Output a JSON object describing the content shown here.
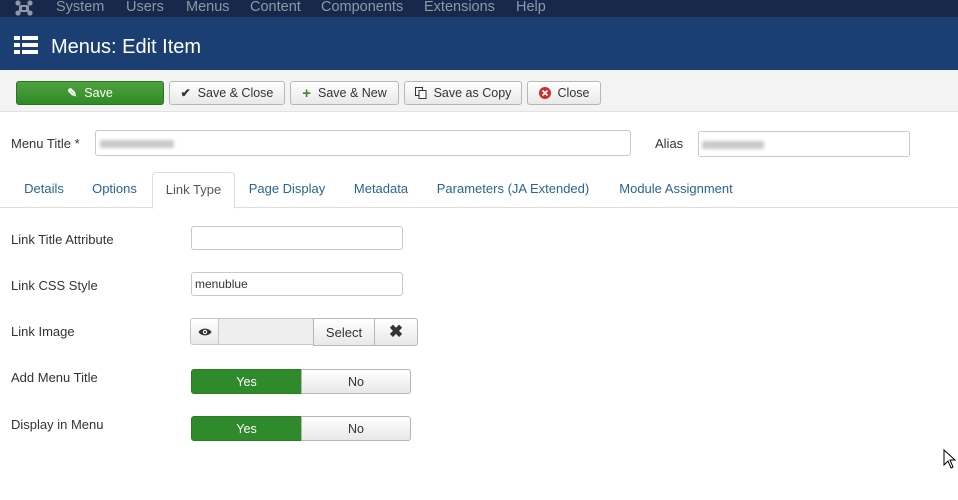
{
  "topnav": {
    "items": [
      "System",
      "Users",
      "Menus",
      "Content",
      "Components",
      "Extensions",
      "Help"
    ]
  },
  "header": {
    "title": "Menus: Edit Item"
  },
  "toolbar": {
    "save": "Save",
    "save_close": "Save & Close",
    "save_new": "Save & New",
    "save_copy": "Save as Copy",
    "close": "Close"
  },
  "fields": {
    "menu_title_label": "Menu Title *",
    "alias_label": "Alias"
  },
  "tabs": [
    "Details",
    "Options",
    "Link Type",
    "Page Display",
    "Metadata",
    "Parameters (JA Extended)",
    "Module Assignment"
  ],
  "active_tab": "Link Type",
  "form": {
    "link_title_attribute_label": "Link Title Attribute",
    "link_title_attribute_value": "",
    "link_css_style_label": "Link CSS Style",
    "link_css_style_value": "menublue",
    "link_image_label": "Link Image",
    "select_label": "Select",
    "add_menu_title_label": "Add Menu Title",
    "display_in_menu_label": "Display in Menu",
    "yes": "Yes",
    "no": "No"
  },
  "colors": {
    "nav_bg": "#17294a",
    "header_bg": "#1b3f73",
    "save_green": "#2f8a25",
    "toggle_green": "#2e8a2a",
    "link_blue": "#2a6496"
  }
}
